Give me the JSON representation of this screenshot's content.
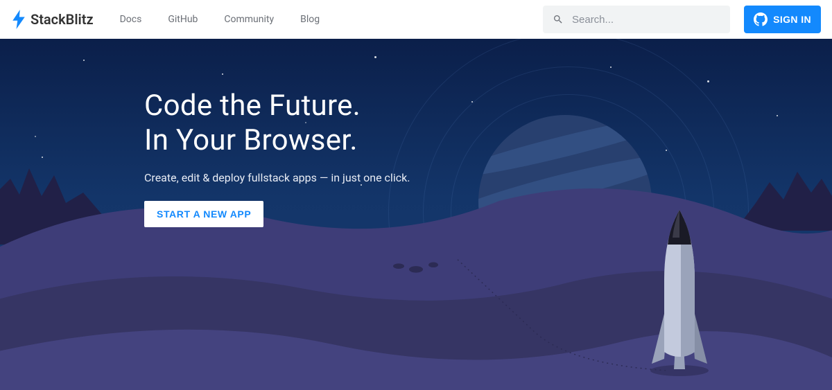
{
  "header": {
    "brand": "StackBlitz",
    "nav": {
      "docs": "Docs",
      "github": "GitHub",
      "community": "Community",
      "blog": "Blog"
    },
    "search_placeholder": "Search...",
    "signin_label": "SIGN IN"
  },
  "hero": {
    "title_line1": "Code the Future.",
    "title_line2": "In Your Browser.",
    "subtitle": "Create, edit & deploy fullstack apps — in just one click.",
    "cta_label": "START A NEW APP"
  },
  "colors": {
    "accent": "#1389fd",
    "hero_top": "#0b1f4a",
    "hero_bottom": "#1a3c70",
    "hills_back": "#3e3d78",
    "hills_mid": "#363564",
    "hills_front": "#44437f",
    "rocket_body": "#b6bfd4",
    "rocket_shadow": "#8e97ae"
  },
  "icons": {
    "bolt": "bolt-icon",
    "search": "search-icon",
    "github": "github-icon"
  }
}
